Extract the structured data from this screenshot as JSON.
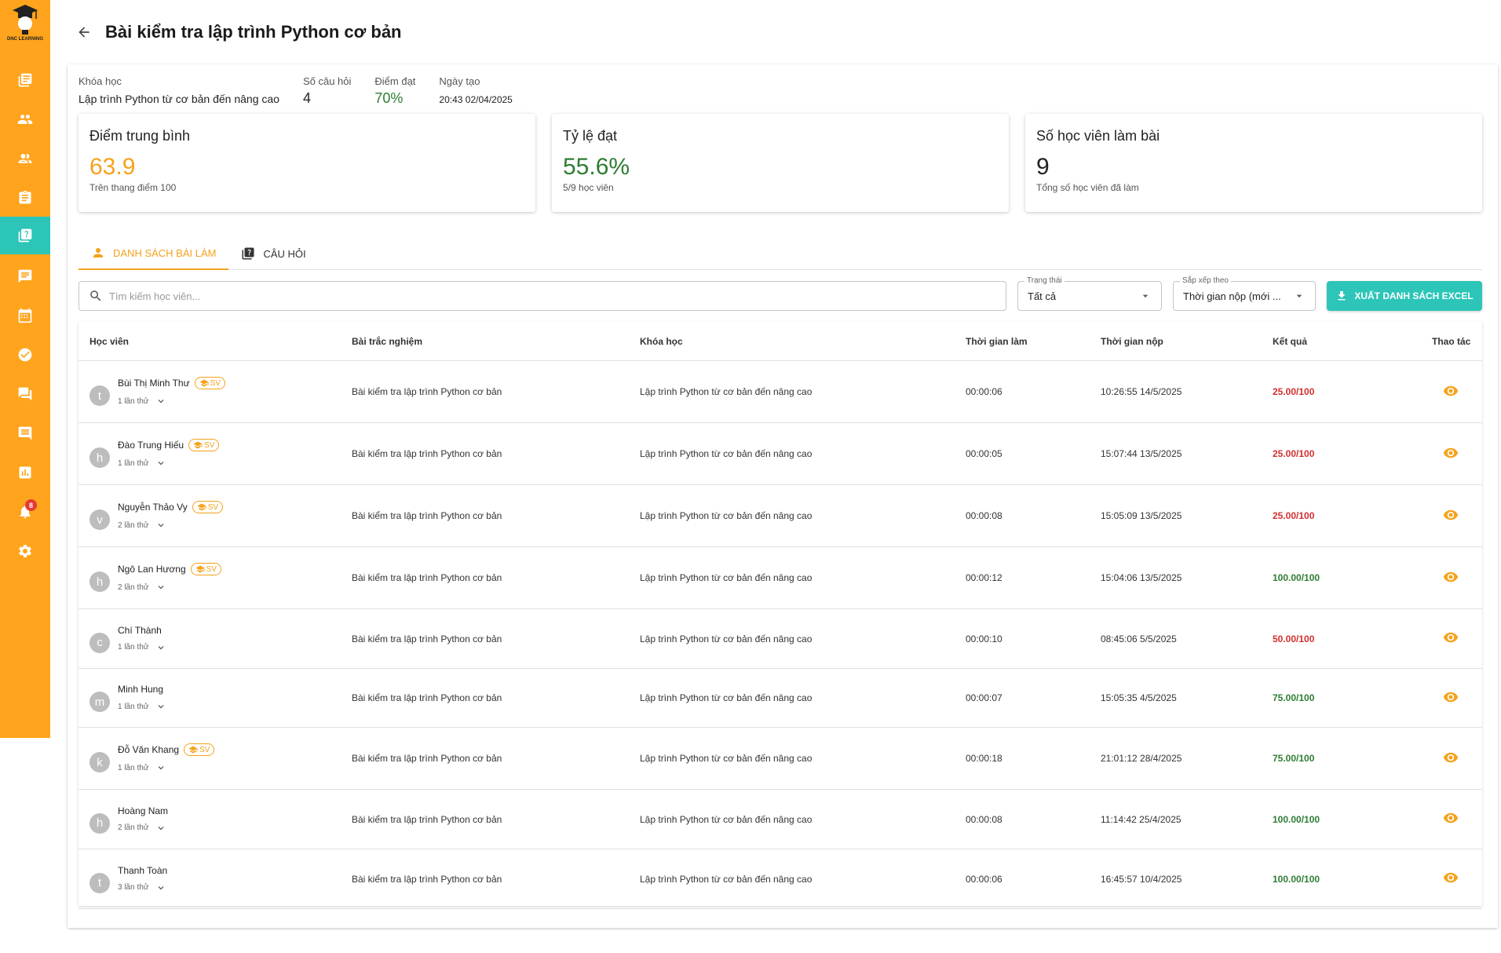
{
  "app": {
    "logo_text": "DNC LEARNING",
    "accent": "#ffa41c",
    "teal": "#2cc5b8",
    "notification_count": "8"
  },
  "sidebar": [
    {
      "icon": "document-list-icon"
    },
    {
      "icon": "users-icon"
    },
    {
      "icon": "people-group-icon"
    },
    {
      "icon": "clipboard-icon"
    },
    {
      "icon": "quiz-icon",
      "active": true
    },
    {
      "icon": "message-icon"
    },
    {
      "icon": "calendar-icon"
    },
    {
      "icon": "check-circle-icon"
    },
    {
      "icon": "forum-icon"
    },
    {
      "icon": "comment-icon"
    },
    {
      "icon": "chart-icon"
    },
    {
      "icon": "bell-icon"
    },
    {
      "icon": "gear-icon"
    }
  ],
  "header": {
    "title": "Bài kiểm tra lập trình Python cơ bản"
  },
  "info": {
    "course_label": "Khóa học",
    "course_value": "Lập trình Python từ cơ bản đến nâng cao",
    "questions_label": "Số câu hỏi",
    "questions_value": "4",
    "pass_label": "Điểm đạt",
    "pass_value": "70%",
    "created_label": "Ngày tạo",
    "created_value": "20:43 02/04/2025"
  },
  "stats": {
    "avg_title": "Điểm trung bình",
    "avg_value": "63.9",
    "avg_sub": "Trên thang điểm 100",
    "rate_title": "Tỷ lệ đạt",
    "rate_value": "55.6%",
    "rate_sub": "5/9 học viên",
    "count_title": "Số học viên làm bài",
    "count_value": "9",
    "count_sub": "Tổng số học viên đã làm"
  },
  "tabs": {
    "submissions": "DANH SÁCH BÀI LÀM",
    "questions": "CÂU HỎI"
  },
  "filters": {
    "search_placeholder": "Tìm kiếm học viên...",
    "status_label": "Trạng thái",
    "status_value": "Tất cả",
    "sort_label": "Sắp xếp theo",
    "sort_value": "Thời gian nộp (mới ...",
    "export_label": "XUẤT DANH SÁCH EXCEL"
  },
  "table": {
    "headers": [
      "Học viên",
      "Bài trắc nghiệm",
      "Khóa học",
      "Thời gian làm",
      "Thời gian nộp",
      "Kết quả",
      "Thao tác"
    ],
    "rows": [
      {
        "initial": "t",
        "name": "Bùi Thị Minh Thư",
        "sv": true,
        "sv_label": "SV",
        "attempts": "1 lần thử",
        "quiz": "Bài kiểm tra lập trình Python cơ bản",
        "course": "Lập trình Python từ cơ bản đến nâng cao",
        "duration": "00:00:06",
        "submitted": "10:26:55 14/5/2025",
        "score": "25.00/100",
        "pass": false
      },
      {
        "initial": "h",
        "name": "Đào Trung Hiếu",
        "sv": true,
        "sv_label": "SV",
        "attempts": "1 lần thử",
        "quiz": "Bài kiểm tra lập trình Python cơ bản",
        "course": "Lập trình Python từ cơ bản đến nâng cao",
        "duration": "00:00:05",
        "submitted": "15:07:44 13/5/2025",
        "score": "25.00/100",
        "pass": false
      },
      {
        "initial": "v",
        "name": "Nguyễn Thảo Vy",
        "sv": true,
        "sv_label": "SV",
        "attempts": "2 lần thử",
        "quiz": "Bài kiểm tra lập trình Python cơ bản",
        "course": "Lập trình Python từ cơ bản đến nâng cao",
        "duration": "00:00:08",
        "submitted": "15:05:09 13/5/2025",
        "score": "25.00/100",
        "pass": false
      },
      {
        "initial": "h",
        "name": "Ngô Lan Hương",
        "sv": true,
        "sv_label": "SV",
        "attempts": "2 lần thử",
        "quiz": "Bài kiểm tra lập trình Python cơ bản",
        "course": "Lập trình Python từ cơ bản đến nâng cao",
        "duration": "00:00:12",
        "submitted": "15:04:06 13/5/2025",
        "score": "100.00/100",
        "pass": true
      },
      {
        "initial": "c",
        "name": "Chí Thành",
        "sv": false,
        "attempts": "1 lần thử",
        "quiz": "Bài kiểm tra lập trình Python cơ bản",
        "course": "Lập trình Python từ cơ bản đến nâng cao",
        "duration": "00:00:10",
        "submitted": "08:45:06 5/5/2025",
        "score": "50.00/100",
        "pass": false
      },
      {
        "initial": "m",
        "name": "Minh Hung",
        "sv": false,
        "attempts": "1 lần thử",
        "quiz": "Bài kiểm tra lập trình Python cơ bản",
        "course": "Lập trình Python từ cơ bản đến nâng cao",
        "duration": "00:00:07",
        "submitted": "15:05:35 4/5/2025",
        "score": "75.00/100",
        "pass": true
      },
      {
        "initial": "k",
        "name": "Đỗ Văn Khang",
        "sv": true,
        "sv_label": "SV",
        "attempts": "1 lần thử",
        "quiz": "Bài kiểm tra lập trình Python cơ bản",
        "course": "Lập trình Python từ cơ bản đến nâng cao",
        "duration": "00:00:18",
        "submitted": "21:01:12 28/4/2025",
        "score": "75.00/100",
        "pass": true
      },
      {
        "initial": "h",
        "name": "Hoàng Nam",
        "sv": false,
        "attempts": "2 lần thử",
        "quiz": "Bài kiểm tra lập trình Python cơ bản",
        "course": "Lập trình Python từ cơ bản đến nâng cao",
        "duration": "00:00:08",
        "submitted": "11:14:42 25/4/2025",
        "score": "100.00/100",
        "pass": true
      },
      {
        "initial": "t",
        "name": "Thanh Toàn",
        "sv": false,
        "attempts": "3 lần thử",
        "quiz": "Bài kiểm tra lập trình Python cơ bản",
        "course": "Lập trình Python từ cơ bản đến nâng cao",
        "duration": "00:00:06",
        "submitted": "16:45:57 10/4/2025",
        "score": "100.00/100",
        "pass": true
      }
    ]
  }
}
